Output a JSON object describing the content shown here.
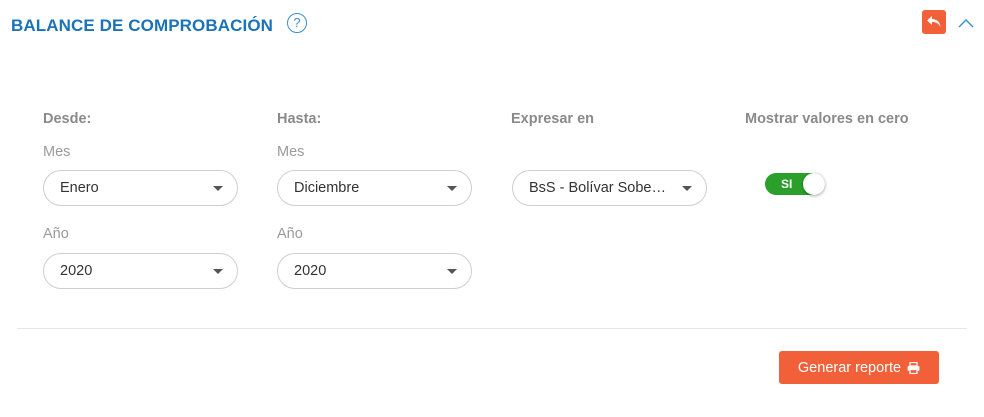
{
  "header": {
    "title": "BALANCE DE COMPROBACIÓN",
    "help_icon": "question-circle-icon",
    "help_glyph": "?",
    "back_icon": "reply-icon",
    "collapse_icon": "chevron-up-icon"
  },
  "desde": {
    "label": "Desde:",
    "mes_label": "Mes",
    "mes_value": "Enero",
    "anio_label": "Año",
    "anio_value": "2020"
  },
  "hasta": {
    "label": "Hasta:",
    "mes_label": "Mes",
    "mes_value": "Diciembre",
    "anio_label": "Año",
    "anio_value": "2020"
  },
  "expresar": {
    "label": "Expresar en",
    "value": "BsS - Bolívar Soberano"
  },
  "mostrar_cero": {
    "label": "Mostrar valores en cero",
    "toggle_text": "SI",
    "enabled": true
  },
  "actions": {
    "generar_label": "Generar reporte",
    "generar_icon": "print-icon"
  },
  "colors": {
    "title_blue": "#1a73b8",
    "accent_orange": "#f2603a",
    "toggle_green": "#2aa02a"
  }
}
